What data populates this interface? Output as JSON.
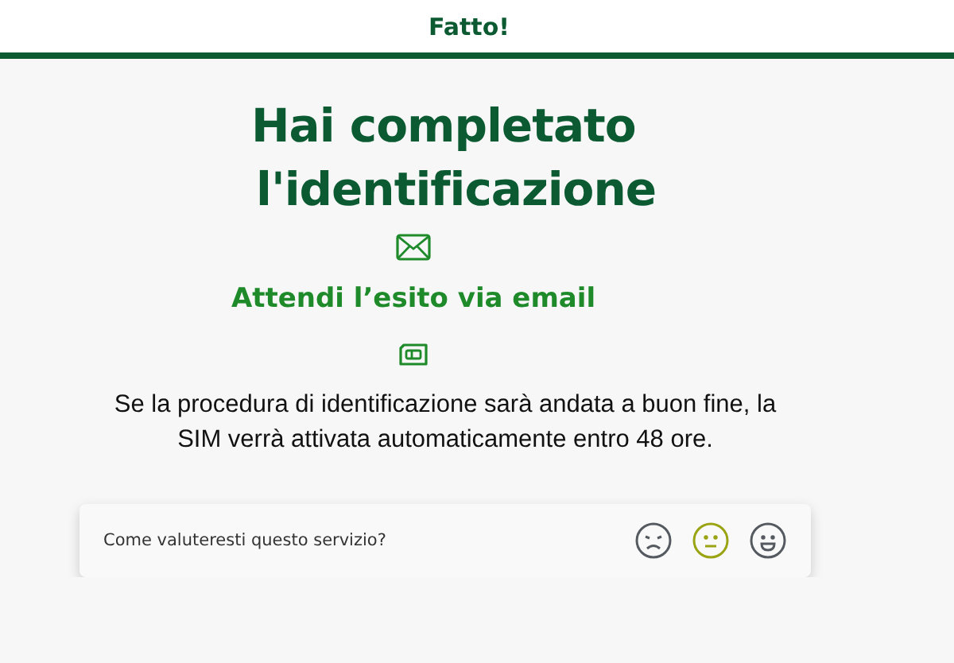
{
  "header": {
    "title": "Fatto!"
  },
  "heading": [
    "Hai completato",
    "l'identificazione"
  ],
  "subtitle": "Attendi l’esito via email",
  "message": "Se la procedura di identificazione sarà andata a buon fine, la SIM verrà attivata automaticamente entro 48 ore.",
  "rating": {
    "question": "Come valuteresti questo servizio?",
    "faces": [
      {
        "kind": "sad",
        "selected": false
      },
      {
        "kind": "neutral",
        "selected": true
      },
      {
        "kind": "happy",
        "selected": false
      }
    ]
  }
}
